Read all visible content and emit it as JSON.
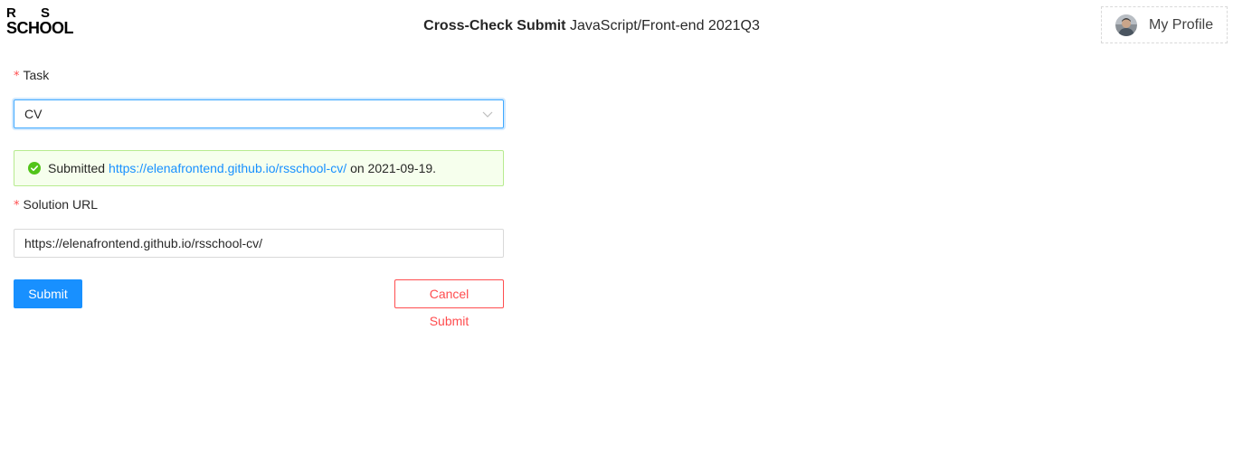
{
  "header": {
    "logo": {
      "line1_left": "R",
      "line1_right": "S",
      "line2": "SCHOOL"
    },
    "title_strong": "Cross-Check Submit",
    "title_rest": "JavaScript/Front-end 2021Q3",
    "profile_label": "My Profile"
  },
  "form": {
    "task": {
      "required_mark": "*",
      "label": "Task",
      "selected_value": "CV"
    },
    "alert": {
      "prefix": "Submitted",
      "link_text": "https://elenafrontend.github.io/rsschool-cv/",
      "suffix": "on 2021-09-19."
    },
    "solution_url": {
      "required_mark": "*",
      "label": "Solution URL",
      "value": "https://elenafrontend.github.io/rsschool-cv/"
    },
    "buttons": {
      "submit": "Submit",
      "cancel": "Cancel Submit"
    }
  },
  "colors": {
    "primary": "#1890ff",
    "danger": "#ff4d4f",
    "success": "#52c41a",
    "success_bg": "#f6ffed",
    "success_border": "#b7eb8f"
  },
  "icons": {
    "alert_icon": "check-circle-icon",
    "select_icon": "chevron-down-icon",
    "profile_icon": "avatar"
  }
}
